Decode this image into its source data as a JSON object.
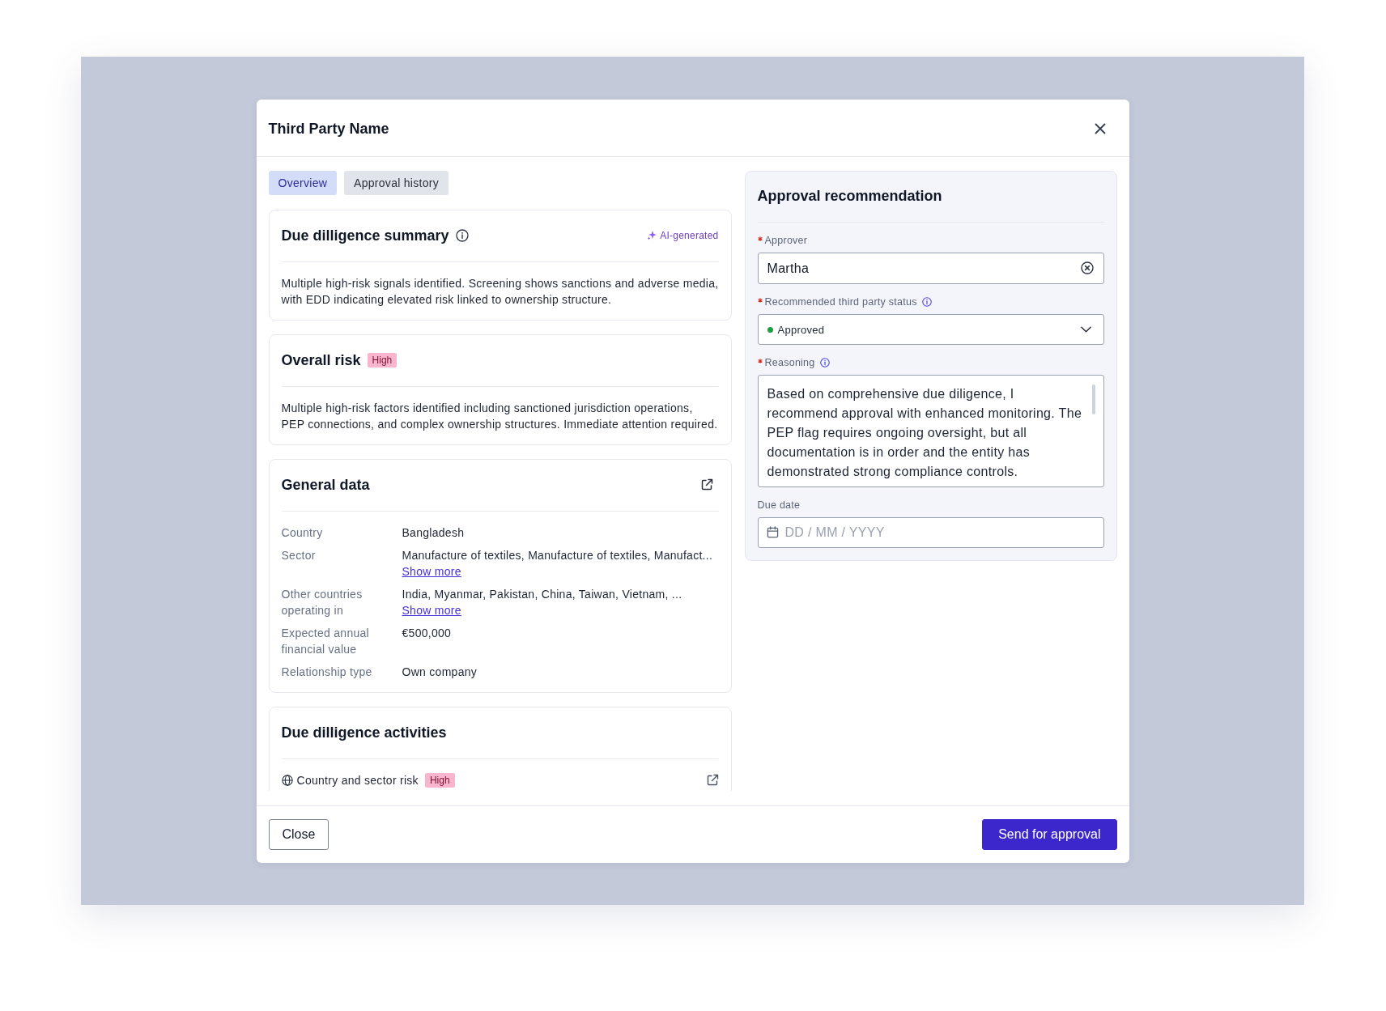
{
  "modal": {
    "title": "Third Party Name"
  },
  "tabs": [
    {
      "label": "Overview",
      "selected": true
    },
    {
      "label": "Approval history",
      "selected": false
    }
  ],
  "due_diligence_summary": {
    "title": "Due dilligence summary",
    "tag": "AI-generated",
    "text": "Multiple high-risk signals identified. Screening shows sanctions and adverse media, with EDD indicating elevated risk linked to ownership structure."
  },
  "overall_risk": {
    "title": "Overall risk",
    "badge": "High",
    "text": "Multiple high-risk factors identified including sanctioned jurisdiction operations, PEP connections, and complex ownership structures. Immediate attention required."
  },
  "general_data": {
    "title": "General data",
    "rows": [
      {
        "label": "Country",
        "value": "Bangladesh"
      },
      {
        "label": "Sector",
        "value": "Manufacture of textiles, Manufacture of textiles, Manufact...",
        "link": "Show more"
      },
      {
        "label": "Other countries operating in",
        "value": "India, Myanmar, Pakistan, China, Taiwan, Vietnam, ...",
        "link": "Show more"
      },
      {
        "label": "Expected annual financial value",
        "value": "€500,000"
      },
      {
        "label": "Relationship type",
        "value": "Own company"
      }
    ]
  },
  "due_diligence_activities": {
    "title": "Due dilligence activities",
    "items": [
      {
        "label": "Country and sector risk",
        "badge": "High"
      }
    ]
  },
  "approval_recommendation": {
    "title": "Approval recommendation",
    "fields": [
      {
        "kind": "text",
        "label": "Approver",
        "required": true,
        "info": false,
        "value": "Martha"
      },
      {
        "kind": "select",
        "label": "Recommended third party status",
        "required": true,
        "info": true,
        "value": "Approved",
        "color": "#1f9d46"
      },
      {
        "kind": "textarea",
        "label": "Reasoning",
        "required": true,
        "info": true,
        "value": "Based on comprehensive due diligence, I recommend approval with enhanced monitoring. The PEP flag requires ongoing oversight, but all documentation is in order and the entity has demonstrated strong compliance controls."
      },
      {
        "kind": "date",
        "label": "Due date",
        "required": false,
        "info": false,
        "placeholder": "DD / MM / YYYY"
      }
    ]
  },
  "footer": {
    "buttons": [
      {
        "label": "Close",
        "kind": "secondary"
      },
      {
        "label": "Send for approval",
        "kind": "primary"
      }
    ]
  }
}
